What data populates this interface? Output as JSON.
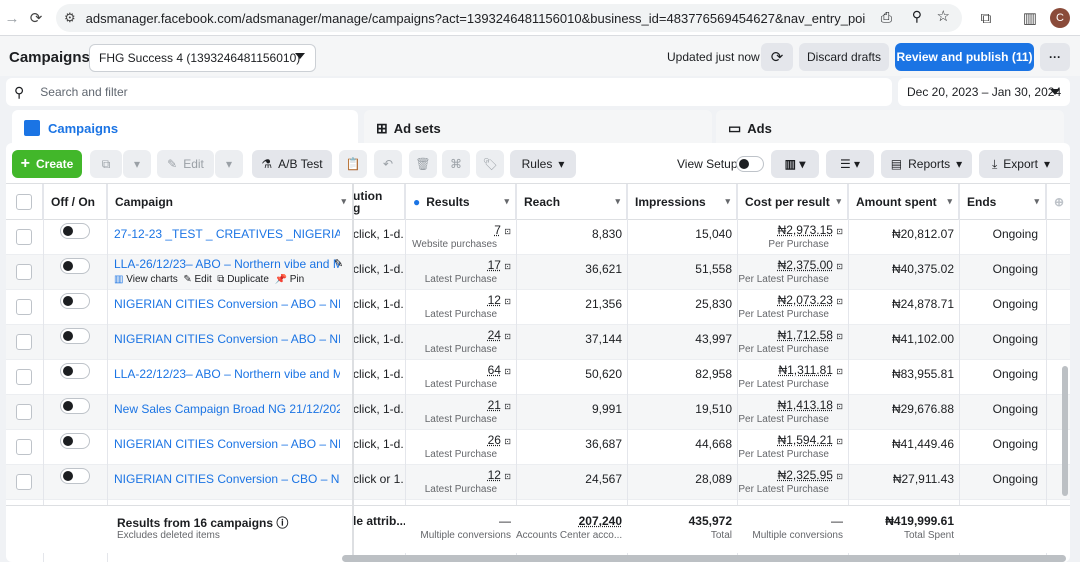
{
  "browser": {
    "url": "adsmanager.facebook.com/adsmanager/manage/campaigns?act=1393246481156010&business_id=483776569454627&nav_entry_point=ads_ecosys...",
    "avatar": "C"
  },
  "header": {
    "title": "Campaigns",
    "account": "FHG Success 4 (1393246481156010)",
    "updated": "Updated just now",
    "discard": "Discard drafts",
    "review": "Review and publish (11)"
  },
  "search": {
    "placeholder": "Search and filter",
    "date_range": "Dec 20, 2023 – Jan 30, 2024"
  },
  "tabs": {
    "campaigns": "Campaigns",
    "adsets": "Ad sets",
    "ads": "Ads"
  },
  "toolbar": {
    "create": "Create",
    "edit": "Edit",
    "ab_test": "A/B Test",
    "rules": "Rules",
    "view_setup": "View Setup",
    "reports": "Reports",
    "export": "Export"
  },
  "columns": {
    "offon": "Off / On",
    "campaign": "Campaign",
    "attribution": "ution",
    "attribution2": "g",
    "results": "Results",
    "reach": "Reach",
    "impressions": "Impressions",
    "cpr": "Cost per result",
    "spent": "Amount spent",
    "ends": "Ends"
  },
  "hover_actions": {
    "view_charts": "View charts",
    "edit": "Edit",
    "duplicate": "Duplicate",
    "pin": "Pin"
  },
  "rows": [
    {
      "name": "27-12-23 _TEST _ CREATIVES _NIGERIAN CITI...",
      "attr": "click, 1-d...",
      "result": "7",
      "result_sub": "Website purchases",
      "reach": "8,830",
      "impr": "15,040",
      "cpr": "₦2,973.15",
      "cpr_sub": "Per Purchase",
      "spent": "₦20,812.07",
      "ends": "Ongoing"
    },
    {
      "name": "LLA-26/12/23– ABO – Northern vibe and M...",
      "attr": "click, 1-d...",
      "result": "17",
      "result_sub": "Latest Purchase",
      "reach": "36,621",
      "impr": "51,558",
      "cpr": "₦2,375.00",
      "cpr_sub": "Per Latest Purchase",
      "spent": "₦40,375.02",
      "ends": "Ongoing"
    },
    {
      "name": "NIGERIAN CITIES Conversion – ABO – NEW C...",
      "attr": "click, 1-d...",
      "result": "12",
      "result_sub": "Latest Purchase",
      "reach": "21,356",
      "impr": "25,830",
      "cpr": "₦2,073.23",
      "cpr_sub": "Per Latest Purchase",
      "spent": "₦24,878.71",
      "ends": "Ongoing"
    },
    {
      "name": "NIGERIAN CITIES Conversion – ABO – NEW C...",
      "attr": "click, 1-d...",
      "result": "24",
      "result_sub": "Latest Purchase",
      "reach": "37,144",
      "impr": "43,997",
      "cpr": "₦1,712.58",
      "cpr_sub": "Per Latest Purchase",
      "spent": "₦41,102.00",
      "ends": "Ongoing"
    },
    {
      "name": "LLA-22/12/23– ABO – Northern vibe and Mary...",
      "attr": "click, 1-d...",
      "result": "64",
      "result_sub": "Latest Purchase",
      "reach": "50,620",
      "impr": "82,958",
      "cpr": "₦1,311.81",
      "cpr_sub": "Per Latest Purchase",
      "spent": "₦83,955.81",
      "ends": "Ongoing"
    },
    {
      "name": "New Sales Campaign Broad NG 21/12/2023 C...",
      "attr": "click, 1-d...",
      "result": "21",
      "result_sub": "Latest Purchase",
      "reach": "9,991",
      "impr": "19,510",
      "cpr": "₦1,413.18",
      "cpr_sub": "Per Latest Purchase",
      "spent": "₦29,676.88",
      "ends": "Ongoing"
    },
    {
      "name": "NIGERIAN CITIES Conversion – ABO – NEW C...",
      "attr": "click, 1-d...",
      "result": "26",
      "result_sub": "Latest Purchase",
      "reach": "36,687",
      "impr": "44,668",
      "cpr": "₦1,594.21",
      "cpr_sub": "Per Latest Purchase",
      "spent": "₦41,449.46",
      "ends": "Ongoing"
    },
    {
      "name": "NIGERIAN CITIES Conversion – CBO – NEW C...",
      "attr": "click or 1...",
      "result": "12",
      "result_sub": "Latest Purchase",
      "reach": "24,567",
      "impr": "28,089",
      "cpr": "₦2,325.95",
      "cpr_sub": "Per Latest Purchase",
      "spent": "₦27,911.43",
      "ends": "Ongoing"
    }
  ],
  "summary": {
    "title": "Results from 16 campaigns",
    "sub": "Excludes deleted items",
    "attr": "le attrib...",
    "results": "—",
    "results_sub": "Multiple conversions",
    "reach": "207,240",
    "reach_sub": "Accounts Center acco...",
    "impr": "435,972",
    "impr_sub": "Total",
    "cpr": "—",
    "cpr_sub": "Multiple conversions",
    "spent": "₦419,999.61",
    "spent_sub": "Total Spent"
  },
  "colors": {
    "accent": "#1b74e4",
    "create": "#42b72a"
  }
}
